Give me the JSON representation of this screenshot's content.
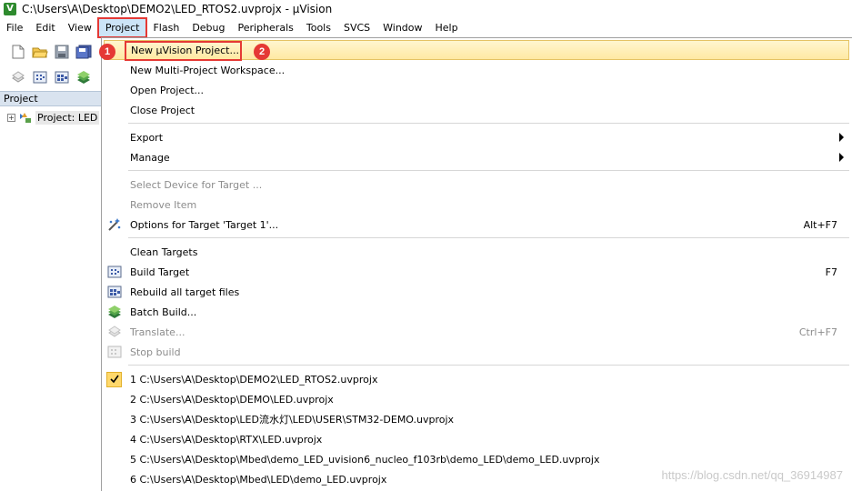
{
  "window": {
    "title": "C:\\Users\\A\\Desktop\\DEMO2\\LED_RTOS2.uvprojx - µVision",
    "app_icon_label": "V"
  },
  "menubar": [
    "File",
    "Edit",
    "View",
    "Project",
    "Flash",
    "Debug",
    "Peripherals",
    "Tools",
    "SVCS",
    "Window",
    "Help"
  ],
  "project_panel": {
    "header": "Project",
    "tree_root": "Project: LED"
  },
  "dropdown": {
    "new_project": "New µVision Project...",
    "new_multi": "New Multi-Project Workspace...",
    "open_project": "Open Project...",
    "close_project": "Close Project",
    "export": "Export",
    "manage": "Manage",
    "select_device": "Select Device for Target ...",
    "remove_item": "Remove Item",
    "options_target": "Options for Target 'Target 1'...",
    "options_shortcut": "Alt+F7",
    "clean_targets": "Clean Targets",
    "build_target": "Build Target",
    "build_shortcut": "F7",
    "rebuild_all": "Rebuild all target files",
    "batch_build": "Batch Build...",
    "translate": "Translate...",
    "translate_shortcut": "Ctrl+F7",
    "stop_build": "Stop build",
    "recent": [
      "1 C:\\Users\\A\\Desktop\\DEMO2\\LED_RTOS2.uvprojx",
      "2 C:\\Users\\A\\Desktop\\DEMO\\LED.uvprojx",
      "3 C:\\Users\\A\\Desktop\\LED流水灯\\LED\\USER\\STM32-DEMO.uvprojx",
      "4 C:\\Users\\A\\Desktop\\RTX\\LED.uvprojx",
      "5 C:\\Users\\A\\Desktop\\Mbed\\demo_LED_uvision6_nucleo_f103rb\\demo_LED\\demo_LED.uvprojx",
      "6 C:\\Users\\A\\Desktop\\Mbed\\LED\\demo_LED.uvprojx"
    ]
  },
  "annotations": {
    "badge_1": "1",
    "badge_2": "2",
    "watermark": "https://blog.csdn.net/qq_36914987"
  },
  "colors": {
    "highlight": "#ffe9a3",
    "annotation_red": "#e53935",
    "panel_header": "#d9e3ef"
  }
}
